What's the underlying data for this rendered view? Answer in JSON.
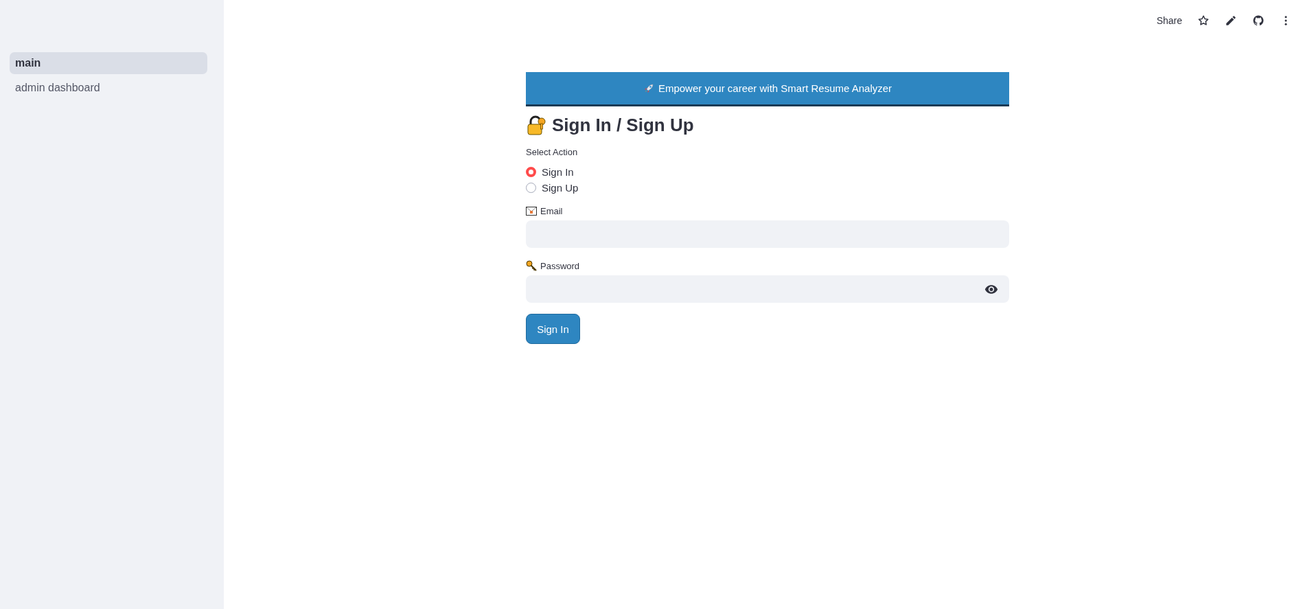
{
  "sidebar": {
    "items": [
      {
        "label": "main",
        "selected": true
      },
      {
        "label": "admin dashboard",
        "selected": false
      }
    ]
  },
  "toolbar": {
    "share": "Share"
  },
  "banner": {
    "text": "Empower your career with Smart Resume Analyzer"
  },
  "heading": "Sign In / Sign Up",
  "action": {
    "label": "Select Action",
    "options": [
      {
        "label": "Sign In",
        "selected": true
      },
      {
        "label": "Sign Up",
        "selected": false
      }
    ]
  },
  "fields": [
    {
      "kind": "email",
      "label": "Email"
    },
    {
      "kind": "password",
      "label": "Password"
    }
  ],
  "submit": "Sign In"
}
